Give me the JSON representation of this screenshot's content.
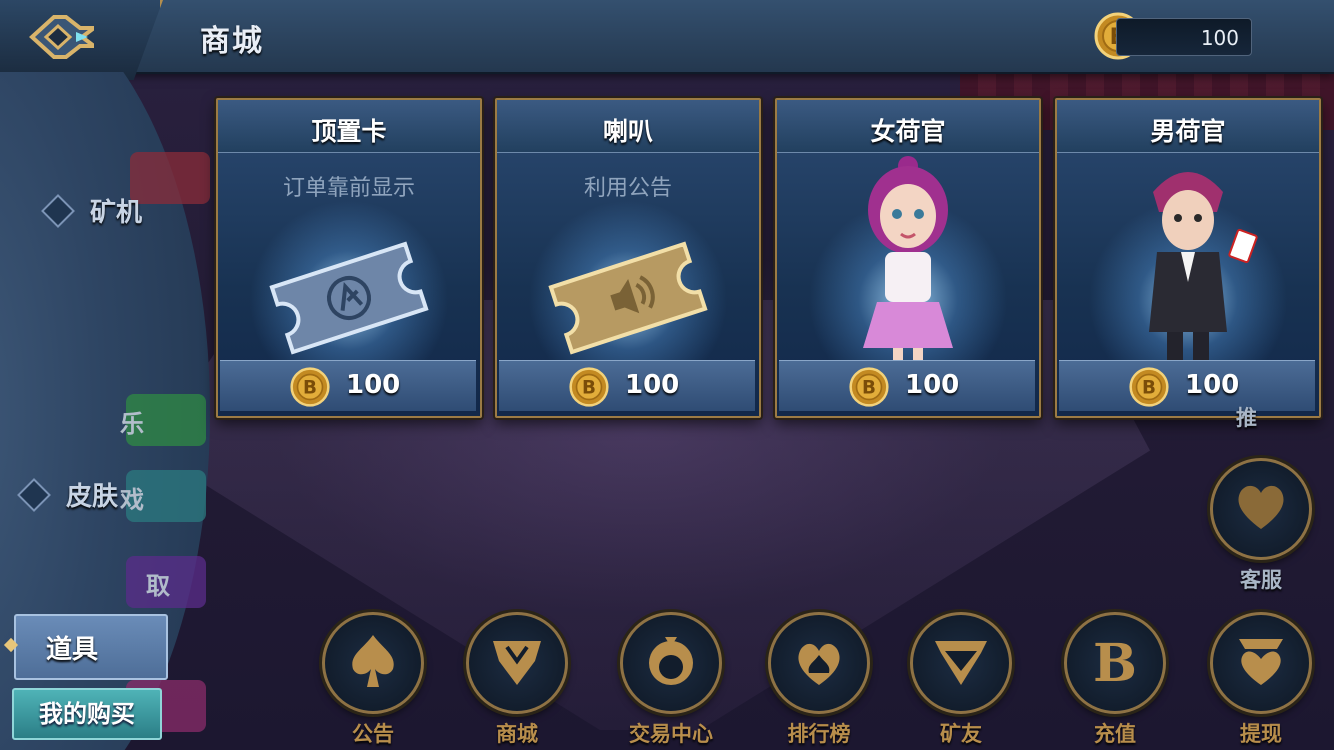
{
  "header": {
    "title": "商城",
    "coin_balance": "100"
  },
  "sidebar": {
    "items": [
      {
        "label": "矿机"
      },
      {
        "label": "皮肤"
      },
      {
        "label": "道具"
      }
    ],
    "my_purchases": "我的购买",
    "partial_tabs": [
      "乐",
      "戏",
      "取"
    ]
  },
  "cards": [
    {
      "title": "顶置卡",
      "subtitle": "订单靠前显示",
      "price": "100"
    },
    {
      "title": "喇叭",
      "subtitle": "利用公告",
      "price": "100"
    },
    {
      "title": "女荷官",
      "subtitle": "",
      "price": "100"
    },
    {
      "title": "男荷官",
      "subtitle": "",
      "price": "100"
    }
  ],
  "bottom_nav": [
    {
      "label": "公告",
      "icon": "spade-icon"
    },
    {
      "label": "商城",
      "icon": "shop-icon"
    },
    {
      "label": "交易中心",
      "icon": "club-icon"
    },
    {
      "label": "排行榜",
      "icon": "ranking-icon"
    },
    {
      "label": "矿友",
      "icon": "friends-icon"
    },
    {
      "label": "充值",
      "icon": "b-coin-icon"
    },
    {
      "label": "提现",
      "icon": "heart-icon"
    }
  ],
  "service": {
    "label": "客服",
    "partial_label": "推"
  },
  "colors": {
    "gold": "#b88e4c",
    "panel_blue": "#183252",
    "top_bar": "#2d4663",
    "teal_button": "#3a9aa0"
  }
}
